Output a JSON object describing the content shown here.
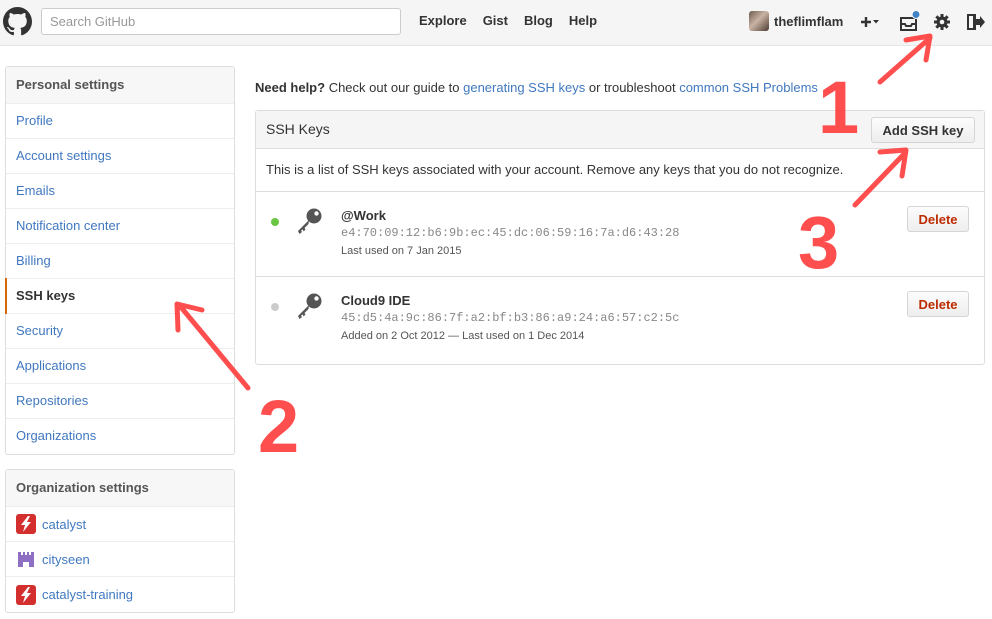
{
  "header": {
    "search_placeholder": "Search GitHub",
    "nav": [
      "Explore",
      "Gist",
      "Blog",
      "Help"
    ],
    "username": "theflimflam",
    "notification_color": "#4183c4"
  },
  "sidebar": {
    "personal_heading": "Personal settings",
    "items": [
      {
        "label": "Profile"
      },
      {
        "label": "Account settings"
      },
      {
        "label": "Emails"
      },
      {
        "label": "Notification center"
      },
      {
        "label": "Billing"
      },
      {
        "label": "SSH keys",
        "selected": true
      },
      {
        "label": "Security"
      },
      {
        "label": "Applications"
      },
      {
        "label": "Repositories"
      },
      {
        "label": "Organizations"
      }
    ],
    "org_heading": "Organization settings",
    "orgs": [
      {
        "label": "catalyst"
      },
      {
        "label": "cityseen"
      },
      {
        "label": "catalyst-training"
      }
    ]
  },
  "main": {
    "help_bold": "Need help?",
    "help_text_1": " Check out our guide to ",
    "help_link_1": "generating SSH keys",
    "help_text_2": " or troubleshoot ",
    "help_link_2": "common SSH Problems",
    "box_title": "SSH Keys",
    "add_button": "Add SSH key",
    "description": "This is a list of SSH keys associated with your account. Remove any keys that you do not recognize.",
    "keys": [
      {
        "title": "@Work",
        "fingerprint": "e4:70:09:12:b6:9b:ec:45:dc:06:59:16:7a:d6:43:28",
        "meta": "Last used on 7 Jan 2015",
        "status_color": "#6cc644",
        "delete_label": "Delete"
      },
      {
        "title": "Cloud9 IDE",
        "fingerprint": "45:d5:4a:9c:86:7f:a2:bf:b3:86:a9:24:a6:57:c2:5c",
        "meta": "Added on 2 Oct 2012 — Last used on 1 Dec 2014",
        "status_color": "#cccccc",
        "delete_label": "Delete"
      }
    ]
  },
  "annotations": {
    "color": "#ff3b3b",
    "labels": [
      "1",
      "2",
      "3"
    ]
  }
}
